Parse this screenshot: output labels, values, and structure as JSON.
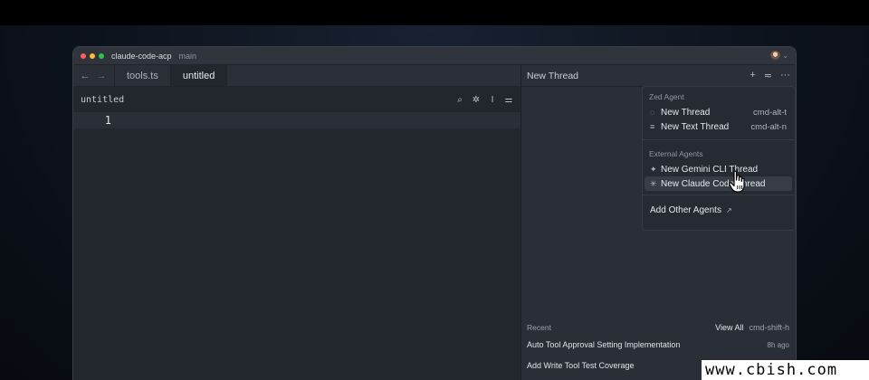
{
  "window": {
    "project": "claude-code-acp",
    "branch": "main",
    "traffic_colors": [
      "#ff5f57",
      "#febc2e",
      "#28c840"
    ]
  },
  "editor": {
    "back_icon": "arrow-left-icon",
    "forward_icon": "arrow-right-icon",
    "tabs": [
      {
        "label": "tools.ts",
        "active": false
      },
      {
        "label": "untitled",
        "active": true
      }
    ],
    "breadcrumb": "untitled",
    "tools": [
      "search-icon",
      "sparkle-icon",
      "text-cursor-icon",
      "sliders-icon"
    ],
    "line_number": "1"
  },
  "agent": {
    "title": "New Thread",
    "actions": [
      "+",
      "≂",
      "···"
    ],
    "menu": {
      "section1": "Zed Agent",
      "items1": [
        {
          "icon": "chat-bubble-icon",
          "glyph": "◌",
          "label": "New Thread",
          "shortcut": "cmd-alt-t"
        },
        {
          "icon": "text-lines-icon",
          "glyph": "≡",
          "label": "New Text Thread",
          "shortcut": "cmd-alt-n"
        }
      ],
      "section2": "External Agents",
      "items2": [
        {
          "icon": "gemini-star-icon",
          "glyph": "✦",
          "label": "New Gemini CLI Thread"
        },
        {
          "icon": "claude-burst-icon",
          "glyph": "✳",
          "label": "New Claude Code Thread"
        }
      ],
      "add_other": "Add Other Agents",
      "add_other_icon": "arrow-up-right-icon"
    },
    "recent": {
      "label": "Recent",
      "view_all": "View All",
      "view_all_shortcut": "cmd-shift-h",
      "items": [
        {
          "title": "Auto Tool Approval Setting Implementation",
          "ago": "8h ago"
        },
        {
          "title": "Add Write Tool Test Coverage",
          "ago": ""
        }
      ]
    }
  },
  "watermark": "www.cbish.com"
}
